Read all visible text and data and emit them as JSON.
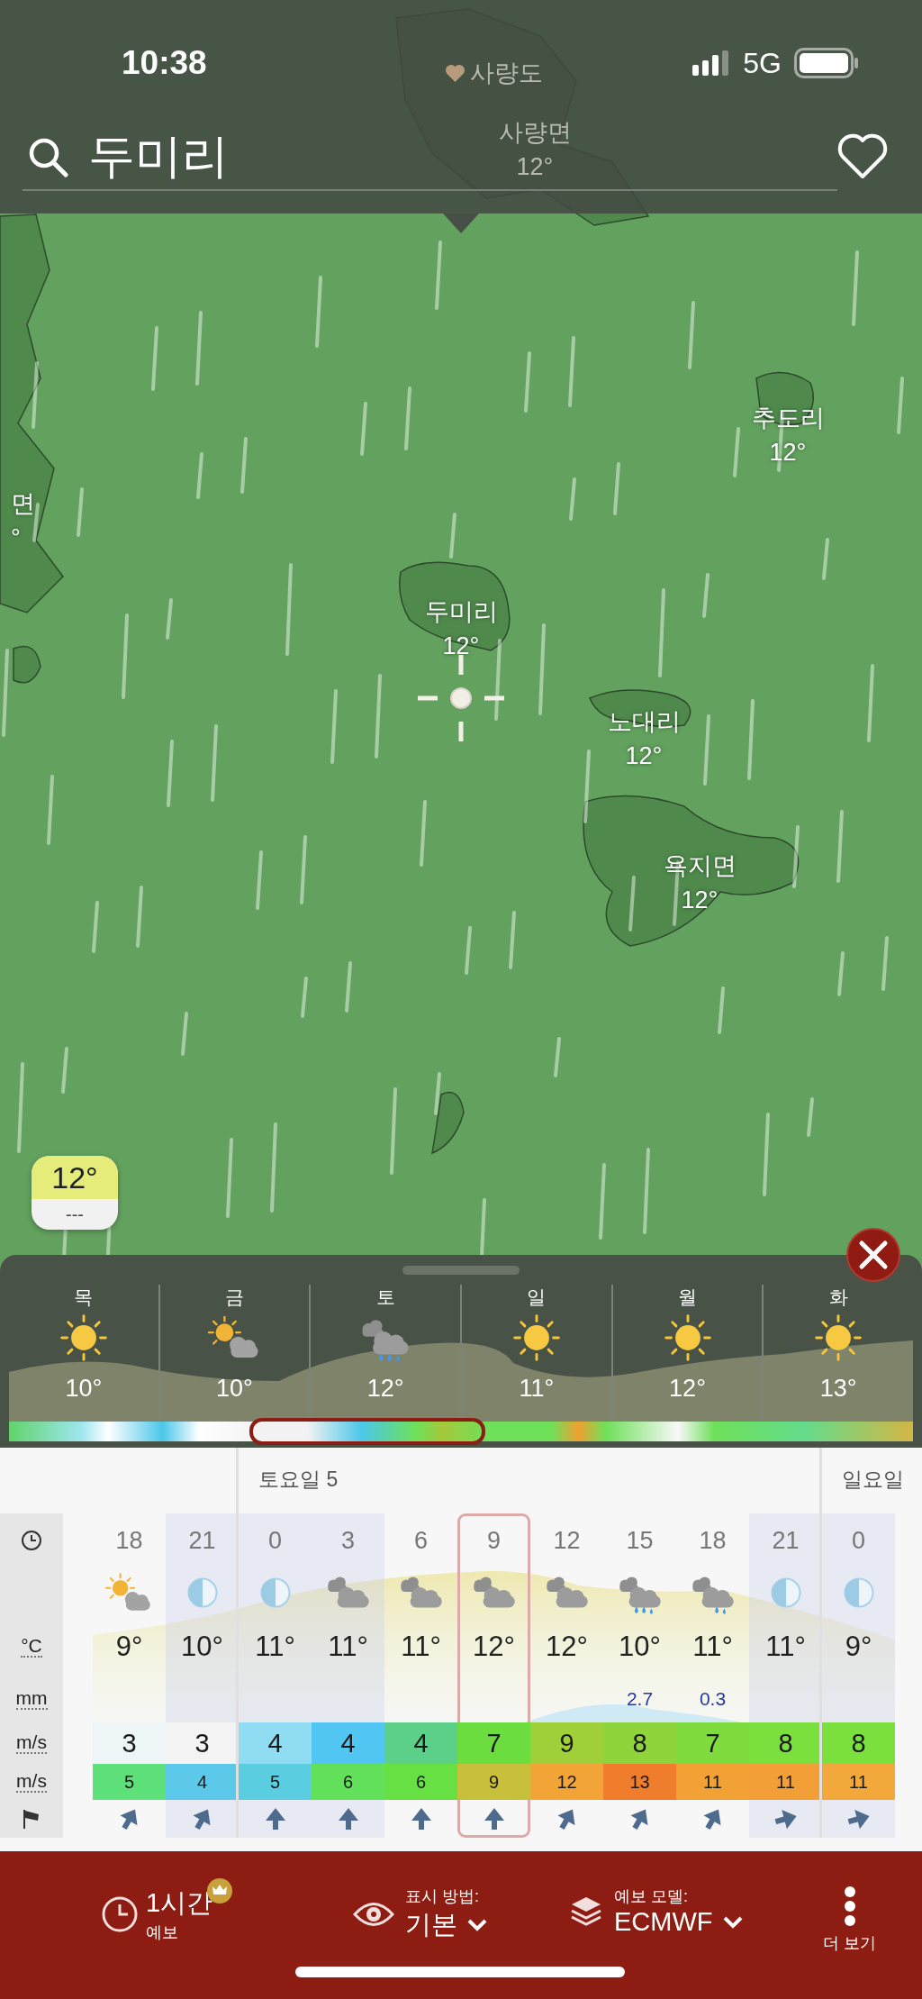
{
  "status_bar": {
    "time": "10:38",
    "network": "5G"
  },
  "search": {
    "value": "두미리"
  },
  "map_labels": [
    {
      "kind": "favorite",
      "name": "사량도"
    },
    {
      "kind": "place",
      "name": "사량면",
      "temp": "12°"
    },
    {
      "kind": "place",
      "name": "추도리",
      "temp": "12°"
    },
    {
      "kind": "place",
      "name": "면",
      "temp": "°"
    },
    {
      "kind": "place",
      "name": "두미리",
      "temp": "12°"
    },
    {
      "kind": "place",
      "name": "노대리",
      "temp": "12°"
    },
    {
      "kind": "place",
      "name": "욕지면",
      "temp": "12°"
    }
  ],
  "temp_badge": {
    "value": "12°",
    "sub": "---"
  },
  "daily": [
    {
      "day": "목",
      "kind": "sun",
      "temp": "10°",
      "selected": false
    },
    {
      "day": "금",
      "kind": "sun-cloud",
      "temp": "10°",
      "selected": false
    },
    {
      "day": "토",
      "kind": "rain",
      "temp": "12°",
      "selected": true
    },
    {
      "day": "일",
      "kind": "sun",
      "temp": "11°",
      "selected": false
    },
    {
      "day": "월",
      "kind": "sun",
      "temp": "12°",
      "selected": false
    },
    {
      "day": "화",
      "kind": "sun",
      "temp": "13°",
      "selected": false
    }
  ],
  "hourly": {
    "row_labels": [
      "°C",
      "mm",
      "m/s",
      "m/s"
    ],
    "hours": [
      {
        "hour": "18",
        "kind": "sun-cloud",
        "temp": "9°",
        "wind": {
          "value": "3",
          "color": "#eef5f7"
        },
        "gust": {
          "value": "5",
          "color": "#5ee07a"
        },
        "arrow": {
          "kind": "ne"
        },
        "night": false,
        "selected": false
      },
      {
        "hour": "21",
        "kind": "moon",
        "temp": "10°",
        "wind": {
          "value": "3",
          "color": "#f3f3f3"
        },
        "gust": {
          "value": "4",
          "color": "#5cc8ea"
        },
        "arrow": {
          "kind": "ne"
        },
        "night": true,
        "selected": false
      },
      {
        "hour": "0",
        "day": "토요일 5",
        "kind": "moon",
        "temp": "11°",
        "wind": {
          "value": "4",
          "color": "#8fdcf3"
        },
        "gust": {
          "value": "5",
          "color": "#5acde0"
        },
        "arrow": {
          "kind": "n"
        },
        "night": true,
        "selected": false
      },
      {
        "hour": "3",
        "kind": "cloud",
        "temp": "11°",
        "wind": {
          "value": "4",
          "color": "#52c6f2"
        },
        "gust": {
          "value": "6",
          "color": "#62e05a"
        },
        "arrow": {
          "kind": "n"
        },
        "night": true,
        "selected": false
      },
      {
        "hour": "6",
        "kind": "cloud",
        "temp": "11°",
        "wind": {
          "value": "4",
          "color": "#5cd089"
        },
        "gust": {
          "value": "6",
          "color": "#66e043"
        },
        "arrow": {
          "kind": "n"
        },
        "night": false,
        "selected": false
      },
      {
        "hour": "9",
        "kind": "cloud",
        "temp": "12°",
        "wind": {
          "value": "7",
          "color": "#6bdd3f"
        },
        "gust": {
          "value": "9",
          "color": "#c8c03a"
        },
        "arrow": {
          "kind": "n"
        },
        "night": false,
        "selected": true
      },
      {
        "hour": "12",
        "kind": "cloud",
        "temp": "12°",
        "wind": {
          "value": "9",
          "color": "#9fd03a"
        },
        "gust": {
          "value": "12",
          "color": "#f3a436"
        },
        "arrow": {
          "kind": "ne"
        },
        "night": false,
        "selected": false
      },
      {
        "hour": "15",
        "kind": "rain",
        "temp": "10°",
        "precip": "2.7",
        "wind": {
          "value": "8",
          "color": "#8fd43a"
        },
        "gust": {
          "value": "13",
          "color": "#ef7d2c"
        },
        "arrow": {
          "kind": "ne"
        },
        "night": false,
        "selected": false
      },
      {
        "hour": "18",
        "kind": "light-rain",
        "temp": "11°",
        "precip": "0.3",
        "wind": {
          "value": "7",
          "color": "#80dc3e"
        },
        "gust": {
          "value": "11",
          "color": "#f2a135"
        },
        "arrow": {
          "kind": "ne"
        },
        "night": false,
        "selected": false
      },
      {
        "hour": "21",
        "kind": "moon",
        "temp": "11°",
        "wind": {
          "value": "8",
          "color": "#7bdf3e"
        },
        "gust": {
          "value": "11",
          "color": "#f19f36"
        },
        "arrow": {
          "kind": "e"
        },
        "night": true,
        "selected": false
      },
      {
        "hour": "0",
        "day": "일요일",
        "kind": "moon",
        "temp": "9°",
        "wind": {
          "value": "8",
          "color": "#7bdf3e"
        },
        "gust": {
          "value": "11",
          "color": "#f2a83a"
        },
        "arrow": {
          "kind": "e"
        },
        "night": true,
        "selected": false
      }
    ]
  },
  "bottom_bar": {
    "interval": {
      "label": "1시간",
      "sub": "예보",
      "premium": true
    },
    "display": {
      "label": "표시 방법:",
      "value": "기본"
    },
    "model": {
      "label": "예보 모델:",
      "value": "ECMWF"
    },
    "more": "더 보기"
  }
}
